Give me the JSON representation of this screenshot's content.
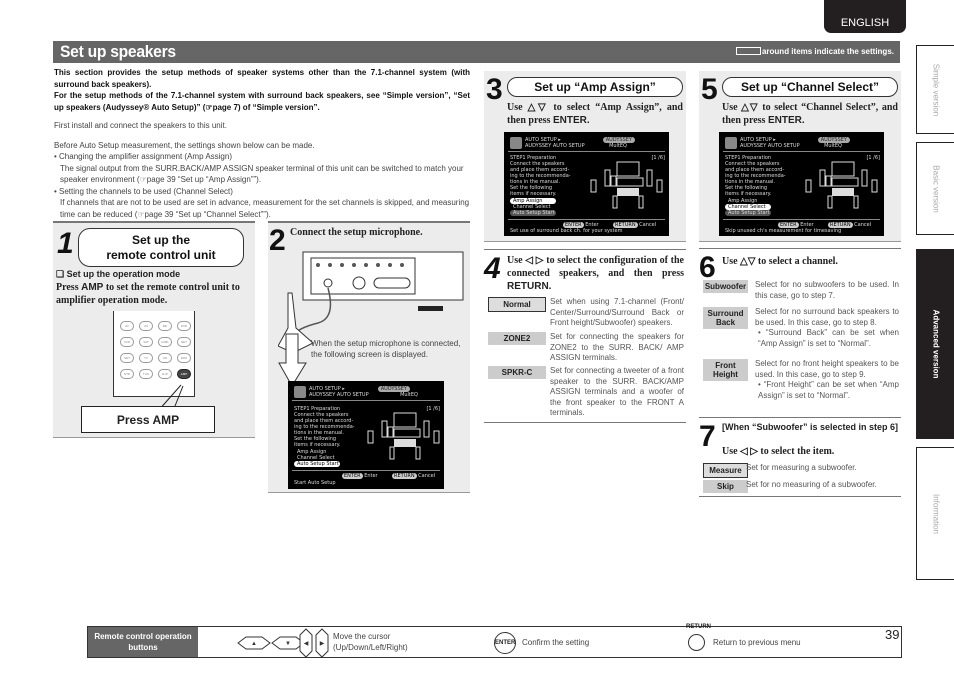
{
  "header": {
    "language": "ENGLISH",
    "title": "Set up speakers",
    "settings_note": "around items indicate the settings."
  },
  "intro": {
    "bold_1": "This section provides the setup methods of speaker systems other than the 7.1-channel system (with surround back speakers).",
    "bold_2": "For the setup methods of the 7.1-channel system with surround back speakers, see “Simple version”, “Set up speakers (Audyssey® Auto Setup)” (☞page 7) of “Simple version”.",
    "line_1": "First install and connect the speakers to this unit.",
    "line_2": "Before Auto Setup measurement, the settings shown below can be made.",
    "bullet_1_title": "• Changing the amplifier assignment (Amp Assign)",
    "bullet_1_body": "The signal output from the SURR.BACK/AMP ASSIGN speaker terminal of this unit can be switched to match your speaker environment (☞page 39 “Set up “Amp Assign””).",
    "bullet_2_title": "• Setting the channels to be used (Channel Select)",
    "bullet_2_body": "If channels that are not to be used are set in advance, measurement for the set channels is skipped, and measuring time can be reduced (☞page 39 “Set up “Channel Select””)."
  },
  "step1": {
    "number": "1",
    "title_1": "Set up the",
    "title_2": "remote control unit",
    "subhead": "❑ Set up the operation mode",
    "instr_pre": "Press ",
    "instr_key": "AMP",
    "instr_post": " to set the remote control unit to amplifier operation mode.",
    "remote_buttons": [
      "Z2",
      "Z3",
      "BD",
      "DVD",
      "VCR",
      "SAT",
      "CABL",
      "NET",
      "SET",
      "TV",
      "CD",
      "DOK",
      "NTR",
      "TUN",
      "E-IP",
      "AMP"
    ],
    "callout": "Press AMP"
  },
  "step2": {
    "number": "2",
    "title": "Connect the setup microphone.",
    "note": "When the setup microphone is connected, the following screen is displayed."
  },
  "osd": {
    "hdr_1": "AUTO SETUP ▸",
    "hdr_2": "AUDYSSEY AUTO SETUP",
    "brand": "AUDYSSEY",
    "multeq": "MultEQ",
    "step": "STEP1 Preparation",
    "page": "[1 /6]",
    "body": [
      "Connect the speakers",
      "and place them accord-",
      "ing to the recommenda-",
      "tions in the manual.",
      "Set the following",
      "items if necessary."
    ],
    "items": [
      "Amp Assign",
      "Channel Select",
      "Auto Setup Start"
    ],
    "enter_key": "ENTER",
    "enter_label": "Enter",
    "return_key": "RETURN",
    "return_label": "Cancel",
    "hint_step2": "Start Auto Setup",
    "hint_step3": "Set use of surround back ch. for your system",
    "hint_step5": "Skip unused ch's measurement for timesaving"
  },
  "step3": {
    "number": "3",
    "title": "Set up “Amp Assign”",
    "instr_pre": "Use △▽ to select “Amp Assign”, and then press ",
    "instr_key": "ENTER."
  },
  "step4": {
    "number": "4",
    "instr_pre": "Use ◁ ▷ to select the configuration of the connected speakers, and then press ",
    "instr_key": "RETURN.",
    "options": [
      {
        "label": "Normal",
        "desc": "Set when using 7.1-channel (Front/ Center/Surround/Surround Back or Front height/Subwoofer) speakers."
      },
      {
        "label": "ZONE2",
        "desc": "Set for connecting the speakers for ZONE2 to the SURR. BACK/ AMP ASSIGN terminals."
      },
      {
        "label": "SPKR-C",
        "desc": "Set for connecting a tweeter of a front speaker to the SURR. BACK/AMP ASSIGN terminals and a woofer of the front speaker to the FRONT A terminals."
      }
    ]
  },
  "step5": {
    "number": "5",
    "title": "Set up “Channel Select”",
    "instr_pre": "Use △▽ to select “Channel Select”, and then press ",
    "instr_key": "ENTER."
  },
  "step6": {
    "number": "6",
    "instr": "Use △▽ to select a channel.",
    "options": [
      {
        "label": "Subwoofer",
        "desc": "Select for no subwoofers to be used. In this case, go to step 7.",
        "note": ""
      },
      {
        "label": "Surround Back",
        "desc": "Select for no surround back speakers to be used. In this case, go to step 8.",
        "note": "• “Surround Back” can be set when “Amp Assign” is set to “Normal”."
      },
      {
        "label": "Front Height",
        "desc": "Select for no front height speakers to be used. In this case, go to step 9.",
        "note": "• “Front Height” can be set when “Amp Assign” is set to “Normal”."
      }
    ]
  },
  "step7": {
    "number": "7",
    "cond": "[When “Subwoofer” is selected in step 6]",
    "instr": "Use ◁ ▷ to select the item.",
    "options": [
      {
        "label": "Measure",
        "desc": "Set for measuring a subwoofer."
      },
      {
        "label": "Skip",
        "desc": "Set for no measuring of a subwoofer."
      }
    ]
  },
  "side_tabs": [
    "Simple version",
    "Basic version",
    "Advanced version",
    "Information"
  ],
  "footer": {
    "header": "Remote control operation buttons",
    "cursor_desc": "Move the cursor (Up/Down/Left/Right)",
    "enter_key": "ENTER",
    "enter_desc": "Confirm the setting",
    "return_key": "RETURN",
    "return_desc": "Return to previous menu",
    "page_number": "39"
  }
}
